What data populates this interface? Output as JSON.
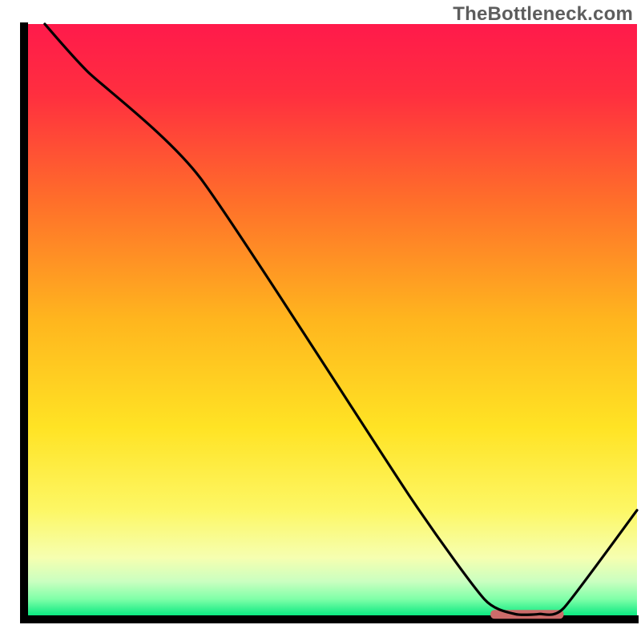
{
  "watermark": "TheBottleneck.com",
  "chart_data": {
    "type": "line",
    "title": "",
    "xlabel": "",
    "ylabel": "",
    "xlim": [
      0,
      100
    ],
    "ylim": [
      0,
      100
    ],
    "series": [
      {
        "name": "curve",
        "x": [
          3,
          10,
          28.5,
          63,
          75,
          80,
          84,
          88,
          100
        ],
        "y": [
          100,
          92,
          74,
          20,
          3,
          0.5,
          0.5,
          1.5,
          18
        ]
      }
    ],
    "optimal_zone": {
      "x_start": 76,
      "x_end": 88,
      "y": 0.5
    },
    "gradient_stops": [
      {
        "offset": 0.0,
        "color": "#ff1a4b"
      },
      {
        "offset": 0.12,
        "color": "#ff2f3f"
      },
      {
        "offset": 0.3,
        "color": "#ff6f2a"
      },
      {
        "offset": 0.5,
        "color": "#ffb61e"
      },
      {
        "offset": 0.68,
        "color": "#ffe324"
      },
      {
        "offset": 0.82,
        "color": "#fdf765"
      },
      {
        "offset": 0.9,
        "color": "#f6ffb0"
      },
      {
        "offset": 0.94,
        "color": "#caffc0"
      },
      {
        "offset": 0.97,
        "color": "#7fffa8"
      },
      {
        "offset": 1.0,
        "color": "#00e77d"
      }
    ],
    "colors": {
      "axis": "#000000",
      "curve": "#000000",
      "optimal": "#cc6b6a"
    }
  }
}
